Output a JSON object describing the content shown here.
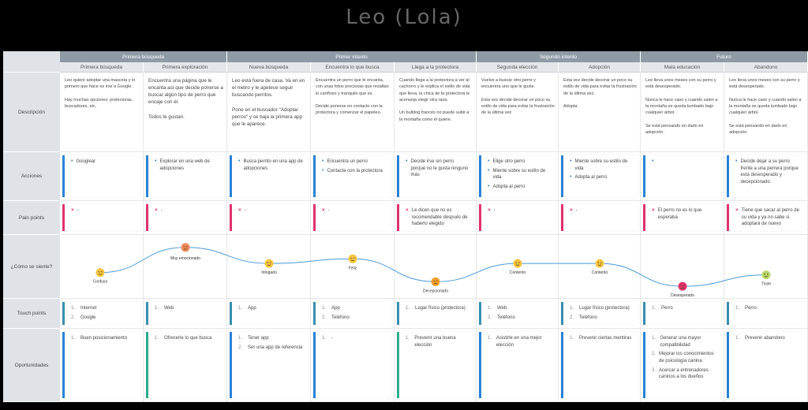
{
  "title": "Leo (Lola)",
  "phases": [
    {
      "label": "Primera búsqueda"
    },
    {
      "label": "Primer intento"
    },
    {
      "label": "Segundo intento"
    },
    {
      "label": "Futuro"
    }
  ],
  "steps": [
    "Primera búsqueda",
    "Primera exploración",
    "Nueva búsqueda",
    "Encuentra lo que busca",
    "Llega a la protectora",
    "Segunda elección",
    "Adopción",
    "Mala educación",
    "Abandono"
  ],
  "rows": [
    "Descripción",
    "Acciones",
    "Pain points",
    "¿Cómo se siente?",
    "Touch points",
    "Oportunidades"
  ],
  "descriptions": [
    "Leo quiere adoptar una mascota y lo primero que hace es irse a Google.\n\nHay muchas opciones: protectoras, buscadores, etc.",
    "Encuentra una página que le encanta así que decide ponerse a buscar algún tipo de perro que encaje con él.\n\nTodos le gustan.",
    "Leo está fuera de casa. Va en en el metro y le apetece seguir buscando perritos.\n\nPone en el buscador \"Adoptar perros\" y se baja la primera app que le aparece.",
    "Encuentra un perro que le encanta, con unas fotos preciosas que resaltan lo cariñoso y tranquilo que es.\n\nDecide ponerse en contacto con la protectora y comenzar el papeleo.",
    "Cuando llega a la protectora a ver al cachorro y le explica el estilo de vida que lleva, la chica de la protectora le aconseja elegir otra raza.\n\nUn bulldog francés no puede subir a la montaña como él quiere.",
    "Vuelve a buscar otro perro y encuentra uno que le guste.\n\nEsta vez decide decorar un poco su estilo de vida para evitar la frustración de la última vez",
    "Esta vez decide decorar un poco su estilo de vida para evitar la frustración de la última vez.\n\nAdopta",
    "Leo lleva unos meses con su perro y está desesperado.\n\nNunca le hace caso y cuando salen a la montaña se queda tumbado bajo cualquier árbol.\n\nSe está pensando en darlo en adopción.",
    "Leo lleva unos meses con su perro y está desesperado.\n\nNunca le hace caso y cuando salen a la montaña se queda tumbado bajo cualquier árbol.\n\nSe está pensando en darlo en adopción."
  ],
  "actions": [
    [
      "Googlear"
    ],
    [
      "Explorar en una web de adopciones"
    ],
    [
      "Busca perrito en una app de adopciones"
    ],
    [
      "Encuentra un perro",
      "Contacta con la protectora"
    ],
    [
      "Decide irse sin perro porque no le gusta ninguno más"
    ],
    [
      "Elige otro perro",
      "Miente sobre su estilo de vida",
      "Adopta al perro"
    ],
    [
      "Miente sobre su estilo de vida",
      "Adopta al perro"
    ],
    [
      ""
    ],
    [
      "Decide dejar a su perro frente a una perrera porque está desesperado y decepcionado"
    ]
  ],
  "pains": [
    "-",
    "-",
    "-",
    "-",
    "Le dicen que no es recomendable después de haberlo elegido",
    "-",
    "-",
    "El perro no es lo que esperaba",
    "Tiene que sacar al perro de su vida y ya no sabe si adoptará de nuevo"
  ],
  "feelings": [
    "Confuso",
    "Muy emocionado",
    "Intrigado",
    "Feliz",
    "Decepcionado",
    "Contento",
    "Contento",
    "Desesperado",
    "Triste"
  ],
  "feeling_levels": [
    0.35,
    0.9,
    0.55,
    0.65,
    0.15,
    0.55,
    0.55,
    0.05,
    0.3
  ],
  "touch": [
    [
      "Internet",
      "Google"
    ],
    [
      "Web"
    ],
    [
      "App"
    ],
    [
      "App",
      "Teléfono"
    ],
    [
      "Lugar físico (protectora)"
    ],
    [
      "Web",
      "Teléfono"
    ],
    [
      "Lugar físico (protectora)",
      "Teléfono"
    ],
    [
      "Perro"
    ],
    [
      "Perro"
    ]
  ],
  "opportunities": [
    [
      "Buen posicionamiento"
    ],
    [
      "Ofrecerle lo que busca"
    ],
    [
      "Tener app",
      "Ser una app de referencia"
    ],
    [
      "-"
    ],
    [
      "Prevenir una buena elección"
    ],
    [
      "Asistirle en una mejor elección"
    ],
    [
      "Prevenir ciertas mentiras"
    ],
    [
      "Generar una mayor compatibilidad",
      "Mejorar los conocimientos de psicología canina",
      "Acercar a entrenadores caninos a los dueños"
    ],
    [
      "Prevenir abandono"
    ]
  ]
}
